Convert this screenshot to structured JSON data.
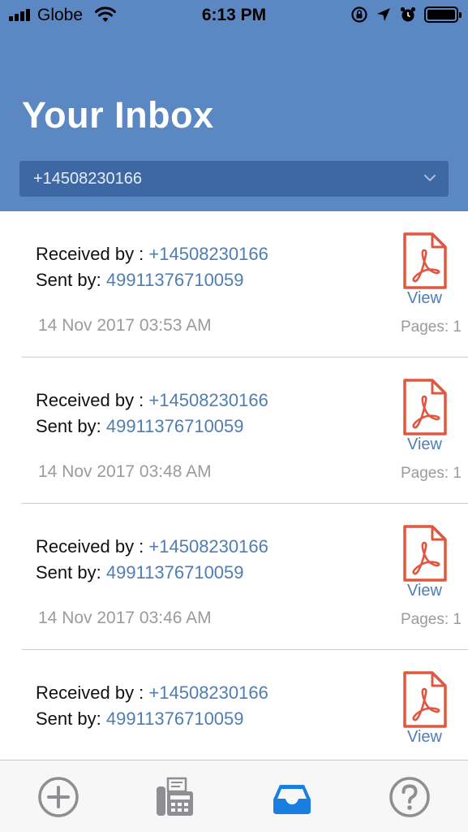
{
  "status_bar": {
    "carrier": "Globe",
    "time": "6:13 PM"
  },
  "header": {
    "title": "Your Inbox",
    "selected_number": "+14508230166"
  },
  "faxes": [
    {
      "received_label": "Received by : ",
      "received_number": "+14508230166",
      "sent_label": "Sent by: ",
      "sent_number": "49911376710059",
      "date": "14 Nov 2017 03:53 AM",
      "view_label": "View",
      "pages": "Pages: 1"
    },
    {
      "received_label": "Received by : ",
      "received_number": "+14508230166",
      "sent_label": "Sent by: ",
      "sent_number": "49911376710059",
      "date": "14 Nov 2017 03:48 AM",
      "view_label": "View",
      "pages": "Pages: 1"
    },
    {
      "received_label": "Received by : ",
      "received_number": "+14508230166",
      "sent_label": "Sent by: ",
      "sent_number": "49911376710059",
      "date": "14 Nov 2017 03:46 AM",
      "view_label": "View",
      "pages": "Pages: 1"
    },
    {
      "received_label": "Received by : ",
      "received_number": "+14508230166",
      "sent_label": "Sent by: ",
      "sent_number": "49911376710059",
      "date": "",
      "view_label": "View",
      "pages": ""
    }
  ],
  "tabbar": {
    "tabs": [
      {
        "icon": "add-circle-icon",
        "active": false
      },
      {
        "icon": "fax-machine-icon",
        "active": false
      },
      {
        "icon": "inbox-tray-icon",
        "active": true
      },
      {
        "icon": "help-question-icon",
        "active": false
      }
    ]
  },
  "colors": {
    "header_bg": "#5b88c3",
    "selector_bg": "#3e68a3",
    "link_blue": "#4e7eb5",
    "pdf_red": "#e0573f",
    "active_tab": "#1a7ee0",
    "inactive_tab": "#8e8e93"
  }
}
